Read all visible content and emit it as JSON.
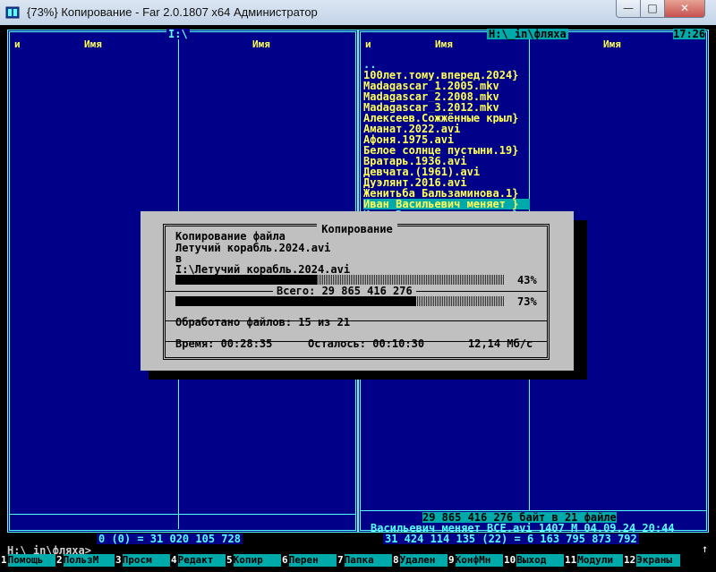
{
  "window": {
    "title": "{73%} Копирование - Far 2.0.1807 x64 Администратор",
    "buttons": {
      "minimize": "—",
      "maximize": "□",
      "close": "✕"
    }
  },
  "left_panel": {
    "path": "I:\\",
    "col1_header": "и",
    "col2_header": "Имя",
    "col3_header": "Имя",
    "footer": "0 (0) = 31 020 105 728"
  },
  "right_panel": {
    "path": "H:\\_in\\фляха",
    "time": "17:26",
    "col1_header": "и",
    "col2_header": "Имя",
    "col3_header": "Имя",
    "files": [
      {
        "name": "..",
        "style": "normal"
      },
      {
        "name": "100лет.тому.вперед.2024}",
        "style": "sel"
      },
      {
        "name": "Madagascar_1.2005.mkv",
        "style": "sel"
      },
      {
        "name": "Madagascar_2.2008.mkv",
        "style": "sel"
      },
      {
        "name": "Madagascar_3.2012.mkv",
        "style": "sel"
      },
      {
        "name": "Алексеев.Сожжённые крыл}",
        "style": "sel"
      },
      {
        "name": "Аманат.2022.avi",
        "style": "sel"
      },
      {
        "name": "Афоня.1975.avi",
        "style": "sel"
      },
      {
        "name": "Белое солнце пустыни.19}",
        "style": "sel"
      },
      {
        "name": "Вратарь.1936.avi",
        "style": "sel"
      },
      {
        "name": "Девчата.(1961).avi",
        "style": "sel"
      },
      {
        "name": "Дуэлянт.2016.avi",
        "style": "sel"
      },
      {
        "name": "Женитьба Бальзаминова.1}",
        "style": "sel"
      },
      {
        "name": "Иван Васильевич меняет }",
        "style": "cur"
      },
      {
        "name": "Иван Васильевич меняет }",
        "style": "cyanrow"
      }
    ],
    "selected_info": "29 865 416 276 байт в 21 файле",
    "file_info": "Васильевич меняет ВСЕ.avi 1407 M 04.09.24 20:44",
    "footer": "31 424 114 135 (22) = 6 163 795 873 792"
  },
  "dialog": {
    "title": "Копирование",
    "line1": "Копирование файла",
    "line2": "Летучий корабль.2024.avi",
    "line3": "в",
    "line4": "I:\\Летучий корабль.2024.avi",
    "file_progress": 43,
    "file_percent": "43%",
    "total_label": "Всего: 29 865 416 276",
    "total_progress": 73,
    "total_percent": "73%",
    "processed": "Обработано файлов: 15 из 21",
    "time": "Время: 00:28:35",
    "remaining": "Осталось: 00:10:30",
    "speed": "12,14 Мб/с"
  },
  "cmdline": "H:\\_in\\фляха>",
  "keybar": [
    {
      "num": "1",
      "label": "Помощь"
    },
    {
      "num": "2",
      "label": "ПользМ"
    },
    {
      "num": "3",
      "label": "Просм"
    },
    {
      "num": "4",
      "label": "Редакт"
    },
    {
      "num": "5",
      "label": "Копир"
    },
    {
      "num": "6",
      "label": "Перен"
    },
    {
      "num": "7",
      "label": "Папка"
    },
    {
      "num": "8",
      "label": "Удален"
    },
    {
      "num": "9",
      "label": "КонфМн"
    },
    {
      "num": "10",
      "label": "Выход"
    },
    {
      "num": "11",
      "label": "Модули"
    },
    {
      "num": "12",
      "label": "Экраны"
    }
  ],
  "icons": {
    "app": "far-manager-icon",
    "up": "up-arrow-icon"
  },
  "colors": {
    "panel_bg": "#000088",
    "frame": "#55ffff",
    "selected": "#ffff55",
    "cursor_bg": "#00aaaa",
    "dialog_bg": "#c0c0c0"
  }
}
